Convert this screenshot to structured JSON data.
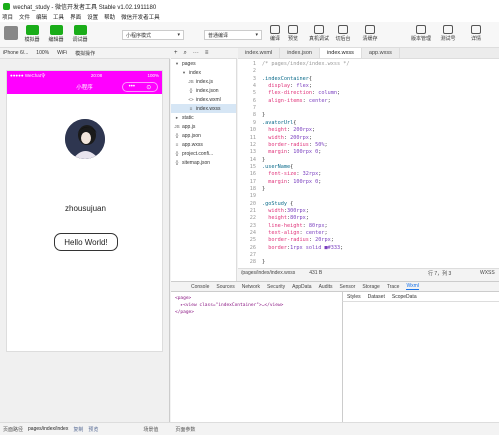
{
  "window": {
    "title": "wechat_study - 微信开发者工具 Stable v1.02.1911180"
  },
  "menu": [
    "项目",
    "文件",
    "编辑",
    "工具",
    "界面",
    "设置",
    "帮助",
    "微信开发者工具"
  ],
  "toolbar": {
    "simulator": "模拟器",
    "editor": "编辑器",
    "debugger": "调试器",
    "mode_select": "小程序模式",
    "compile_select": "普通编译",
    "compile": "编译",
    "preview": "预览",
    "remote_debug": "真机调试",
    "cut_backend": "切后台",
    "clear_cache": "清缓存",
    "version_mgmt": "版本管理",
    "test_account": "测试号",
    "details": "详情"
  },
  "sim_bar": {
    "device": "iPhone 6/...",
    "zoom": "100%",
    "network": "WiFi",
    "operation": "模拟操作"
  },
  "phone": {
    "status_left": "●●●●● WeChat令",
    "status_time": "20:08",
    "status_right": "100%",
    "nav_title": "小程序",
    "capsule_more": "•••",
    "capsule_close": "⊙",
    "username": "zhousujuan",
    "button_label": "Hello World!"
  },
  "tree_bar": {
    "add": "+",
    "search": "⌕",
    "more": "···",
    "layout": "≡"
  },
  "tree": [
    {
      "label": "pages",
      "icon": "▾",
      "indent": 0,
      "selected": false
    },
    {
      "label": "index",
      "icon": "▾",
      "indent": 1,
      "selected": false
    },
    {
      "label": "index.js",
      "icon": "JS",
      "indent": 2,
      "selected": false
    },
    {
      "label": "index.json",
      "icon": "{}",
      "indent": 2,
      "selected": false
    },
    {
      "label": "index.wxml",
      "icon": "<>",
      "indent": 2,
      "selected": false
    },
    {
      "label": "index.wxss",
      "icon": "≡",
      "indent": 2,
      "selected": true
    },
    {
      "label": "static",
      "icon": "▸",
      "indent": 0,
      "selected": false
    },
    {
      "label": "app.js",
      "icon": "JS",
      "indent": 0,
      "selected": false
    },
    {
      "label": "app.json",
      "icon": "{}",
      "indent": 0,
      "selected": false
    },
    {
      "label": "app.wxss",
      "icon": "≡",
      "indent": 0,
      "selected": false
    },
    {
      "label": "project.confi...",
      "icon": "{}",
      "indent": 0,
      "selected": false
    },
    {
      "label": "sitemap.json",
      "icon": "{}",
      "indent": 0,
      "selected": false
    }
  ],
  "tabs": [
    {
      "label": "index.wxml",
      "active": false
    },
    {
      "label": "index.json",
      "active": false
    },
    {
      "label": "index.wxss",
      "active": true
    },
    {
      "label": "app.wxss",
      "active": false
    }
  ],
  "code": [
    [
      [
        "com",
        "/* pages/index/index.wxss */"
      ]
    ],
    [],
    [
      [
        "sel",
        ".indexContainer"
      ],
      [
        "plain",
        "{"
      ]
    ],
    [
      [
        "prop",
        "  display"
      ],
      [
        "plain",
        ": "
      ],
      [
        "val",
        "flex"
      ],
      [
        "plain",
        ";"
      ]
    ],
    [
      [
        "prop",
        "  flex-direction"
      ],
      [
        "plain",
        ": "
      ],
      [
        "val",
        "column"
      ],
      [
        "plain",
        ";"
      ]
    ],
    [
      [
        "prop",
        "  align-items"
      ],
      [
        "plain",
        ": "
      ],
      [
        "val",
        "center"
      ],
      [
        "plain",
        ";"
      ]
    ],
    [],
    [
      [
        "plain",
        "}"
      ]
    ],
    [
      [
        "sel",
        ".avatorUrl"
      ],
      [
        "plain",
        "{"
      ]
    ],
    [
      [
        "prop",
        "  height"
      ],
      [
        "plain",
        ": "
      ],
      [
        "val",
        "200rpx"
      ],
      [
        "plain",
        ";"
      ]
    ],
    [
      [
        "prop",
        "  width"
      ],
      [
        "plain",
        ": "
      ],
      [
        "val",
        "200rpx"
      ],
      [
        "plain",
        ";"
      ]
    ],
    [
      [
        "prop",
        "  border-radius"
      ],
      [
        "plain",
        ": "
      ],
      [
        "val",
        "50%"
      ],
      [
        "plain",
        ";"
      ]
    ],
    [
      [
        "prop",
        "  margin"
      ],
      [
        "plain",
        ": "
      ],
      [
        "val",
        "100rpx 0"
      ],
      [
        "plain",
        ";"
      ]
    ],
    [
      [
        "plain",
        "}"
      ]
    ],
    [
      [
        "sel",
        ".userName"
      ],
      [
        "plain",
        "{"
      ]
    ],
    [
      [
        "prop",
        "  font-size"
      ],
      [
        "plain",
        ": "
      ],
      [
        "val",
        "32rpx"
      ],
      [
        "plain",
        ";"
      ]
    ],
    [
      [
        "prop",
        "  margin"
      ],
      [
        "plain",
        ": "
      ],
      [
        "val",
        "100rpx 0"
      ],
      [
        "plain",
        ";"
      ]
    ],
    [
      [
        "plain",
        "}"
      ]
    ],
    [],
    [
      [
        "sel",
        ".goStudy"
      ],
      [
        "plain",
        " {"
      ]
    ],
    [
      [
        "prop",
        "  width"
      ],
      [
        "plain",
        ":"
      ],
      [
        "val",
        "300rpx"
      ],
      [
        "plain",
        ";"
      ]
    ],
    [
      [
        "prop",
        "  height"
      ],
      [
        "plain",
        ":"
      ],
      [
        "val",
        "80rpx"
      ],
      [
        "plain",
        ";"
      ]
    ],
    [
      [
        "prop",
        "  line-height"
      ],
      [
        "plain",
        ": "
      ],
      [
        "val",
        "80rpx"
      ],
      [
        "plain",
        ";"
      ]
    ],
    [
      [
        "prop",
        "  text-align"
      ],
      [
        "plain",
        ": "
      ],
      [
        "val",
        "center"
      ],
      [
        "plain",
        ";"
      ]
    ],
    [
      [
        "prop",
        "  border-radius"
      ],
      [
        "plain",
        ": "
      ],
      [
        "val",
        "20rpx"
      ],
      [
        "plain",
        ";"
      ]
    ],
    [
      [
        "prop",
        "  border"
      ],
      [
        "plain",
        ":"
      ],
      [
        "val",
        "1rpx solid ■#333"
      ],
      [
        "plain",
        ";"
      ]
    ],
    [],
    [
      [
        "plain",
        "}"
      ]
    ]
  ],
  "editor_status": {
    "path": "/pages/index/index.wxss",
    "size": "431 B",
    "position": "行 7，列 3",
    "lang": "WXSS"
  },
  "devtools": {
    "tabs": [
      "Console",
      "Sources",
      "Network",
      "Security",
      "AppData",
      "Audits",
      "Sensor",
      "Storage",
      "Trace",
      "Wxml"
    ],
    "active_tab": "Wxml",
    "dom": [
      "<page>",
      "  ▸<view class=\"indexContainer\">…</view>",
      "</page>"
    ],
    "side_tabs": [
      "Styles",
      "Dataset",
      "ScopeData"
    ]
  },
  "status": {
    "path_label": "页面路径",
    "path": "pages/index/index",
    "copy": "复制",
    "preview": "预览",
    "scene": "场景值",
    "params": "页面参数"
  },
  "colors": {
    "nav_bg": "#ff00ff",
    "accent": "#1aad19"
  }
}
